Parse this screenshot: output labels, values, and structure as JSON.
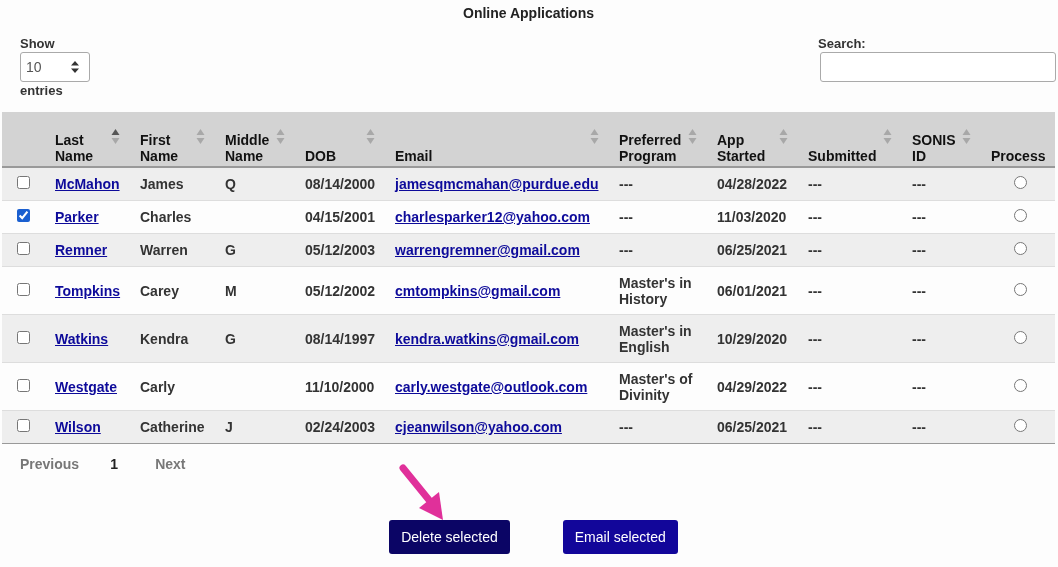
{
  "title": "Online Applications",
  "length_menu": {
    "label_before": "Show",
    "value": "10",
    "label_after": "entries"
  },
  "search": {
    "label": "Search:"
  },
  "table": {
    "columns": [
      {
        "kind": "check"
      },
      {
        "label": "Last Name",
        "kind": "text",
        "sorted": true
      },
      {
        "label": "First Name",
        "kind": "text",
        "sorted": false
      },
      {
        "label": "Middle Name",
        "kind": "text",
        "sorted": false
      },
      {
        "label": "DOB",
        "kind": "text",
        "sorted": false
      },
      {
        "label": "Email",
        "kind": "text",
        "sorted": false
      },
      {
        "label": "Preferred Program",
        "kind": "text",
        "sorted": false
      },
      {
        "label": "App Started",
        "kind": "text",
        "sorted": false
      },
      {
        "label": "Submitted",
        "kind": "text",
        "sorted": false
      },
      {
        "label": "SONIS ID",
        "kind": "text",
        "sorted": false
      },
      {
        "label": "Process",
        "kind": "radio"
      }
    ],
    "rows": [
      {
        "checked": false,
        "last_name": "McMahon",
        "first_name": "James",
        "middle_name": "Q",
        "dob": "08/14/2000",
        "email": "jamesqmcmahan@purdue.edu",
        "preferred_program": "---",
        "app_started": "04/28/2022",
        "submitted": "---",
        "sonis_id": "---",
        "process_selected": false
      },
      {
        "checked": true,
        "last_name": "Parker",
        "first_name": "Charles",
        "dob": "04/15/2001",
        "email": "charlesparker12@yahoo.com",
        "preferred_program": "---",
        "app_started": "11/03/2020",
        "submitted": "---",
        "sonis_id": "---",
        "process_selected": false
      },
      {
        "checked": false,
        "last_name": "Remner",
        "first_name": "Warren",
        "middle_name": "G",
        "dob": "05/12/2003",
        "email": "warrengremner@gmail.com",
        "preferred_program": "---",
        "app_started": "06/25/2021",
        "submitted": "---",
        "sonis_id": "---",
        "process_selected": false
      },
      {
        "checked": false,
        "last_name": "Tompkins",
        "first_name": "Carey",
        "middle_name": "M",
        "dob": "05/12/2002",
        "email": "cmtompkins@gmail.com",
        "preferred_program": "Master's in History",
        "app_started": "06/01/2021",
        "submitted": "---",
        "sonis_id": "---",
        "process_selected": false
      },
      {
        "checked": false,
        "last_name": "Watkins",
        "first_name": "Kendra",
        "middle_name": "G",
        "dob": "08/14/1997",
        "email": "kendra.watkins@gmail.com",
        "preferred_program": "Master's in English",
        "app_started": "10/29/2020",
        "submitted": "---",
        "sonis_id": "---",
        "process_selected": false
      },
      {
        "checked": false,
        "last_name": "Westgate",
        "first_name": "Carly",
        "dob": "11/10/2000",
        "email": "carly.westgate@outlook.com",
        "preferred_program": "Master's of Divinity",
        "app_started": "04/29/2022",
        "submitted": "---",
        "sonis_id": "---",
        "process_selected": false
      },
      {
        "checked": false,
        "last_name": "Wilson",
        "first_name": "Catherine",
        "middle_name": "J",
        "dob": "02/24/2003",
        "email": "cjeanwilson@yahoo.com",
        "preferred_program": "---",
        "app_started": "06/25/2021",
        "submitted": "---",
        "sonis_id": "---",
        "process_selected": false
      }
    ]
  },
  "pagination": {
    "previous": {
      "label": "Previous",
      "disabled": true
    },
    "pages": [
      {
        "label": "1",
        "selected": true
      }
    ],
    "next": {
      "label": "Next",
      "disabled": true
    }
  },
  "buttons": [
    {
      "label": "Delete selected",
      "focused": true
    },
    {
      "label": "Email selected",
      "focused": false
    }
  ]
}
